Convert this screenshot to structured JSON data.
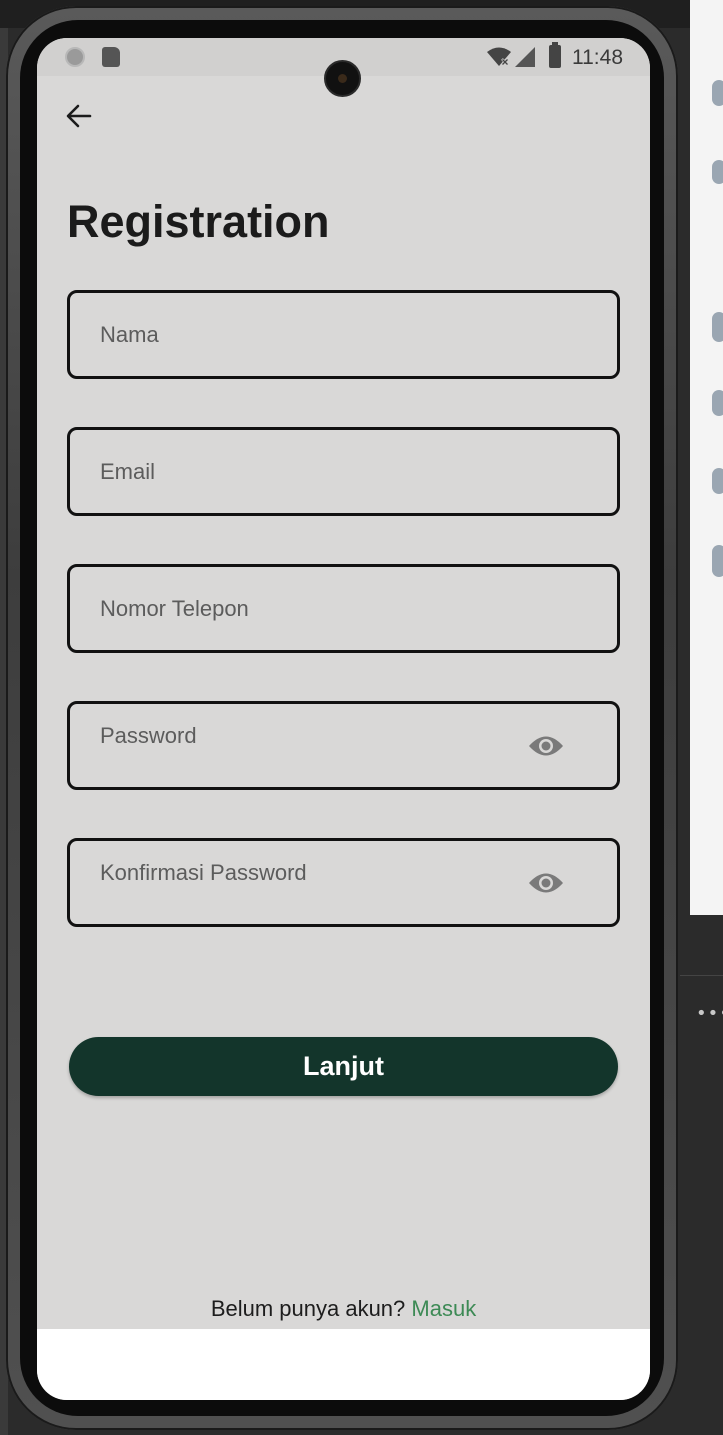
{
  "status_bar": {
    "time": "11:48"
  },
  "header": {
    "title": "Registration"
  },
  "form": {
    "name_placeholder": "Nama",
    "email_placeholder": "Email",
    "phone_placeholder": "Nomor Telepon",
    "password_placeholder": "Password",
    "confirm_password_placeholder": "Konfirmasi Password"
  },
  "actions": {
    "continue_label": "Lanjut"
  },
  "footer": {
    "prompt": "Belum punya akun? ",
    "link_label": "Masuk"
  },
  "colors": {
    "primary_button": "#13352b",
    "link": "#3d8a55",
    "screen_background": "#d9d8d7"
  },
  "icons": [
    "back-arrow-icon",
    "eye-icon",
    "wifi-icon",
    "signal-icon",
    "battery-icon",
    "sd-card-icon"
  ]
}
